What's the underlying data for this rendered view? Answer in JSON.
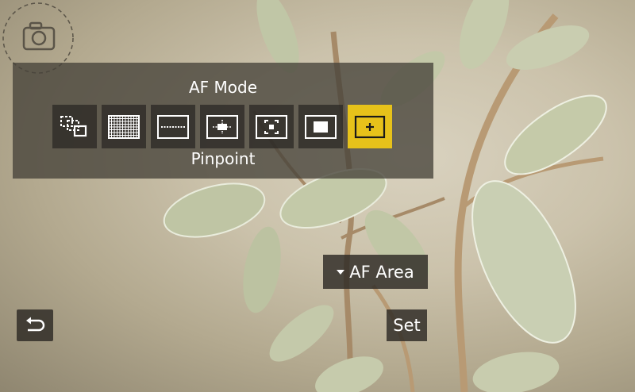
{
  "background": {
    "icon": "camera-icon"
  },
  "af_mode_panel": {
    "title": "AF Mode",
    "selected_mode_name": "Pinpoint",
    "modes": [
      {
        "icon": "tracking-af-icon",
        "selected": false
      },
      {
        "icon": "all-area-af-icon",
        "selected": false
      },
      {
        "icon": "zone-horizontal-af-icon",
        "selected": false
      },
      {
        "icon": "zone-vertical-af-icon",
        "selected": false
      },
      {
        "icon": "one-area-af-icon",
        "selected": false
      },
      {
        "icon": "one-area-plus-af-icon",
        "selected": false
      },
      {
        "icon": "pinpoint-af-icon",
        "selected": true
      }
    ]
  },
  "buttons": {
    "af_area_label": "AF Area",
    "set_label": "Set",
    "back_icon": "return-arrow-icon"
  },
  "colors": {
    "selected_accent": "#e7c21a",
    "panel_bg": "#46423a",
    "text": "#ffffff"
  }
}
